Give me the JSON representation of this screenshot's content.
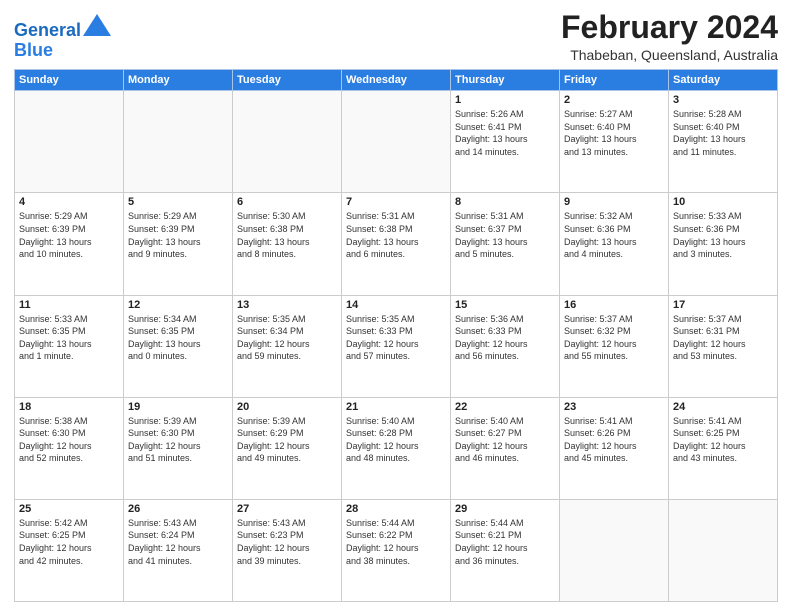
{
  "logo": {
    "line1": "General",
    "line2": "Blue"
  },
  "title": "February 2024",
  "location": "Thabeban, Queensland, Australia",
  "weekdays": [
    "Sunday",
    "Monday",
    "Tuesday",
    "Wednesday",
    "Thursday",
    "Friday",
    "Saturday"
  ],
  "weeks": [
    [
      {
        "day": "",
        "info": ""
      },
      {
        "day": "",
        "info": ""
      },
      {
        "day": "",
        "info": ""
      },
      {
        "day": "",
        "info": ""
      },
      {
        "day": "1",
        "info": "Sunrise: 5:26 AM\nSunset: 6:41 PM\nDaylight: 13 hours\nand 14 minutes."
      },
      {
        "day": "2",
        "info": "Sunrise: 5:27 AM\nSunset: 6:40 PM\nDaylight: 13 hours\nand 13 minutes."
      },
      {
        "day": "3",
        "info": "Sunrise: 5:28 AM\nSunset: 6:40 PM\nDaylight: 13 hours\nand 11 minutes."
      }
    ],
    [
      {
        "day": "4",
        "info": "Sunrise: 5:29 AM\nSunset: 6:39 PM\nDaylight: 13 hours\nand 10 minutes."
      },
      {
        "day": "5",
        "info": "Sunrise: 5:29 AM\nSunset: 6:39 PM\nDaylight: 13 hours\nand 9 minutes."
      },
      {
        "day": "6",
        "info": "Sunrise: 5:30 AM\nSunset: 6:38 PM\nDaylight: 13 hours\nand 8 minutes."
      },
      {
        "day": "7",
        "info": "Sunrise: 5:31 AM\nSunset: 6:38 PM\nDaylight: 13 hours\nand 6 minutes."
      },
      {
        "day": "8",
        "info": "Sunrise: 5:31 AM\nSunset: 6:37 PM\nDaylight: 13 hours\nand 5 minutes."
      },
      {
        "day": "9",
        "info": "Sunrise: 5:32 AM\nSunset: 6:36 PM\nDaylight: 13 hours\nand 4 minutes."
      },
      {
        "day": "10",
        "info": "Sunrise: 5:33 AM\nSunset: 6:36 PM\nDaylight: 13 hours\nand 3 minutes."
      }
    ],
    [
      {
        "day": "11",
        "info": "Sunrise: 5:33 AM\nSunset: 6:35 PM\nDaylight: 13 hours\nand 1 minute."
      },
      {
        "day": "12",
        "info": "Sunrise: 5:34 AM\nSunset: 6:35 PM\nDaylight: 13 hours\nand 0 minutes."
      },
      {
        "day": "13",
        "info": "Sunrise: 5:35 AM\nSunset: 6:34 PM\nDaylight: 12 hours\nand 59 minutes."
      },
      {
        "day": "14",
        "info": "Sunrise: 5:35 AM\nSunset: 6:33 PM\nDaylight: 12 hours\nand 57 minutes."
      },
      {
        "day": "15",
        "info": "Sunrise: 5:36 AM\nSunset: 6:33 PM\nDaylight: 12 hours\nand 56 minutes."
      },
      {
        "day": "16",
        "info": "Sunrise: 5:37 AM\nSunset: 6:32 PM\nDaylight: 12 hours\nand 55 minutes."
      },
      {
        "day": "17",
        "info": "Sunrise: 5:37 AM\nSunset: 6:31 PM\nDaylight: 12 hours\nand 53 minutes."
      }
    ],
    [
      {
        "day": "18",
        "info": "Sunrise: 5:38 AM\nSunset: 6:30 PM\nDaylight: 12 hours\nand 52 minutes."
      },
      {
        "day": "19",
        "info": "Sunrise: 5:39 AM\nSunset: 6:30 PM\nDaylight: 12 hours\nand 51 minutes."
      },
      {
        "day": "20",
        "info": "Sunrise: 5:39 AM\nSunset: 6:29 PM\nDaylight: 12 hours\nand 49 minutes."
      },
      {
        "day": "21",
        "info": "Sunrise: 5:40 AM\nSunset: 6:28 PM\nDaylight: 12 hours\nand 48 minutes."
      },
      {
        "day": "22",
        "info": "Sunrise: 5:40 AM\nSunset: 6:27 PM\nDaylight: 12 hours\nand 46 minutes."
      },
      {
        "day": "23",
        "info": "Sunrise: 5:41 AM\nSunset: 6:26 PM\nDaylight: 12 hours\nand 45 minutes."
      },
      {
        "day": "24",
        "info": "Sunrise: 5:41 AM\nSunset: 6:25 PM\nDaylight: 12 hours\nand 43 minutes."
      }
    ],
    [
      {
        "day": "25",
        "info": "Sunrise: 5:42 AM\nSunset: 6:25 PM\nDaylight: 12 hours\nand 42 minutes."
      },
      {
        "day": "26",
        "info": "Sunrise: 5:43 AM\nSunset: 6:24 PM\nDaylight: 12 hours\nand 41 minutes."
      },
      {
        "day": "27",
        "info": "Sunrise: 5:43 AM\nSunset: 6:23 PM\nDaylight: 12 hours\nand 39 minutes."
      },
      {
        "day": "28",
        "info": "Sunrise: 5:44 AM\nSunset: 6:22 PM\nDaylight: 12 hours\nand 38 minutes."
      },
      {
        "day": "29",
        "info": "Sunrise: 5:44 AM\nSunset: 6:21 PM\nDaylight: 12 hours\nand 36 minutes."
      },
      {
        "day": "",
        "info": ""
      },
      {
        "day": "",
        "info": ""
      }
    ]
  ]
}
